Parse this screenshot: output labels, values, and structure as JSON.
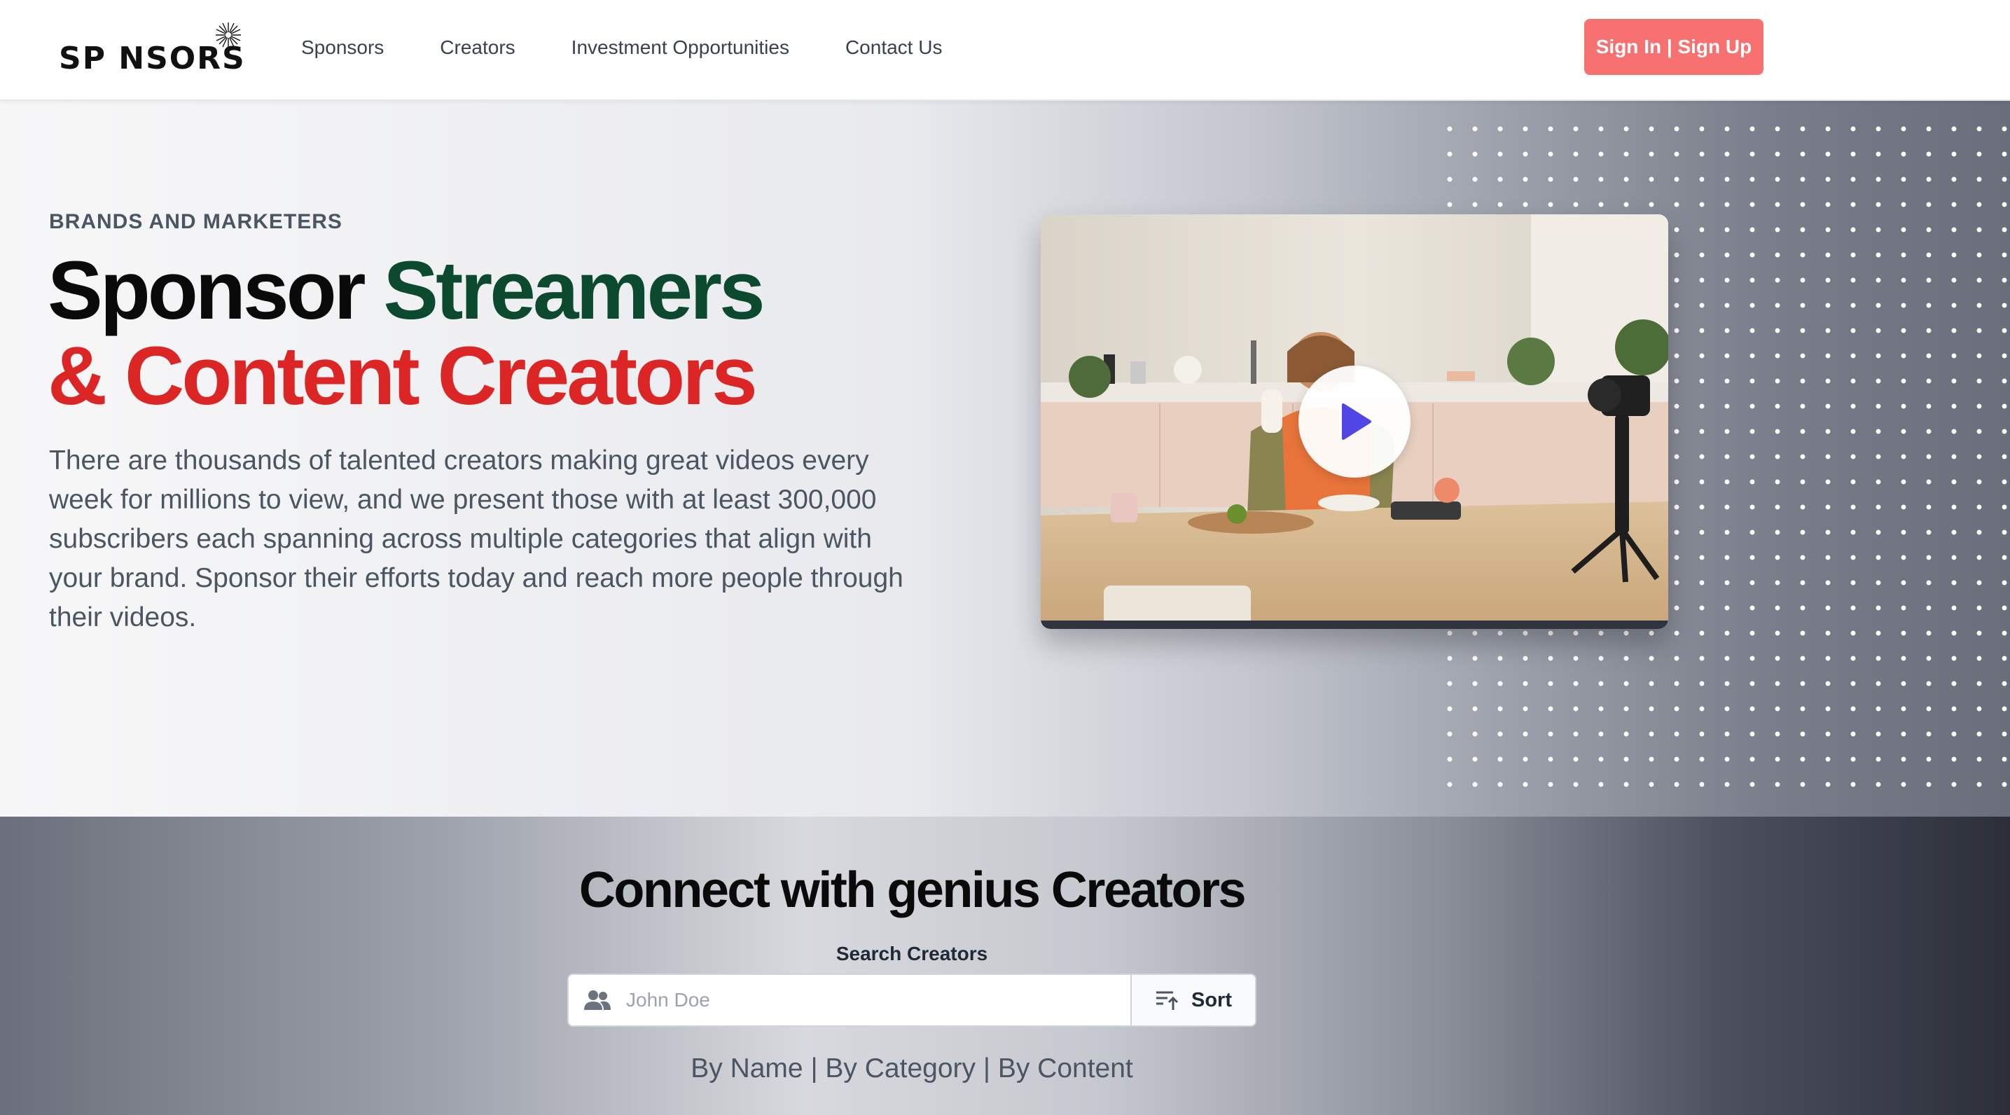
{
  "header": {
    "logo_text": "SP NSORS",
    "nav": [
      {
        "label": "Sponsors"
      },
      {
        "label": "Creators"
      },
      {
        "label": "Investment Opportunities"
      },
      {
        "label": "Contact Us"
      }
    ],
    "auth_button": "Sign In | Sign Up"
  },
  "hero": {
    "eyebrow": "BRANDS AND MARKETERS",
    "headline_part1": "Sponsor ",
    "headline_part2": "Streamers",
    "headline_part3": "& Content Creators",
    "description": "There are thousands of talented creators making great videos every week for millions to view, and we present those with at least 300,000 subscribers each spanning across multiple categories that align with your brand. Sponsor their efforts today and reach more people through their videos.",
    "video_icon": "play-icon"
  },
  "search": {
    "title": "Connect with genius Creators",
    "label": "Search Creators",
    "placeholder": "John Doe",
    "input_icon": "users-icon",
    "sort_label": "Sort",
    "sort_icon": "sort-ascending-icon",
    "filter_text": "By Name | By Category | By Content"
  },
  "colors": {
    "accent_red": "#dc2626",
    "accent_green": "#0b4a2e",
    "button_red": "#f87171",
    "play_blue": "#4f46e5"
  }
}
